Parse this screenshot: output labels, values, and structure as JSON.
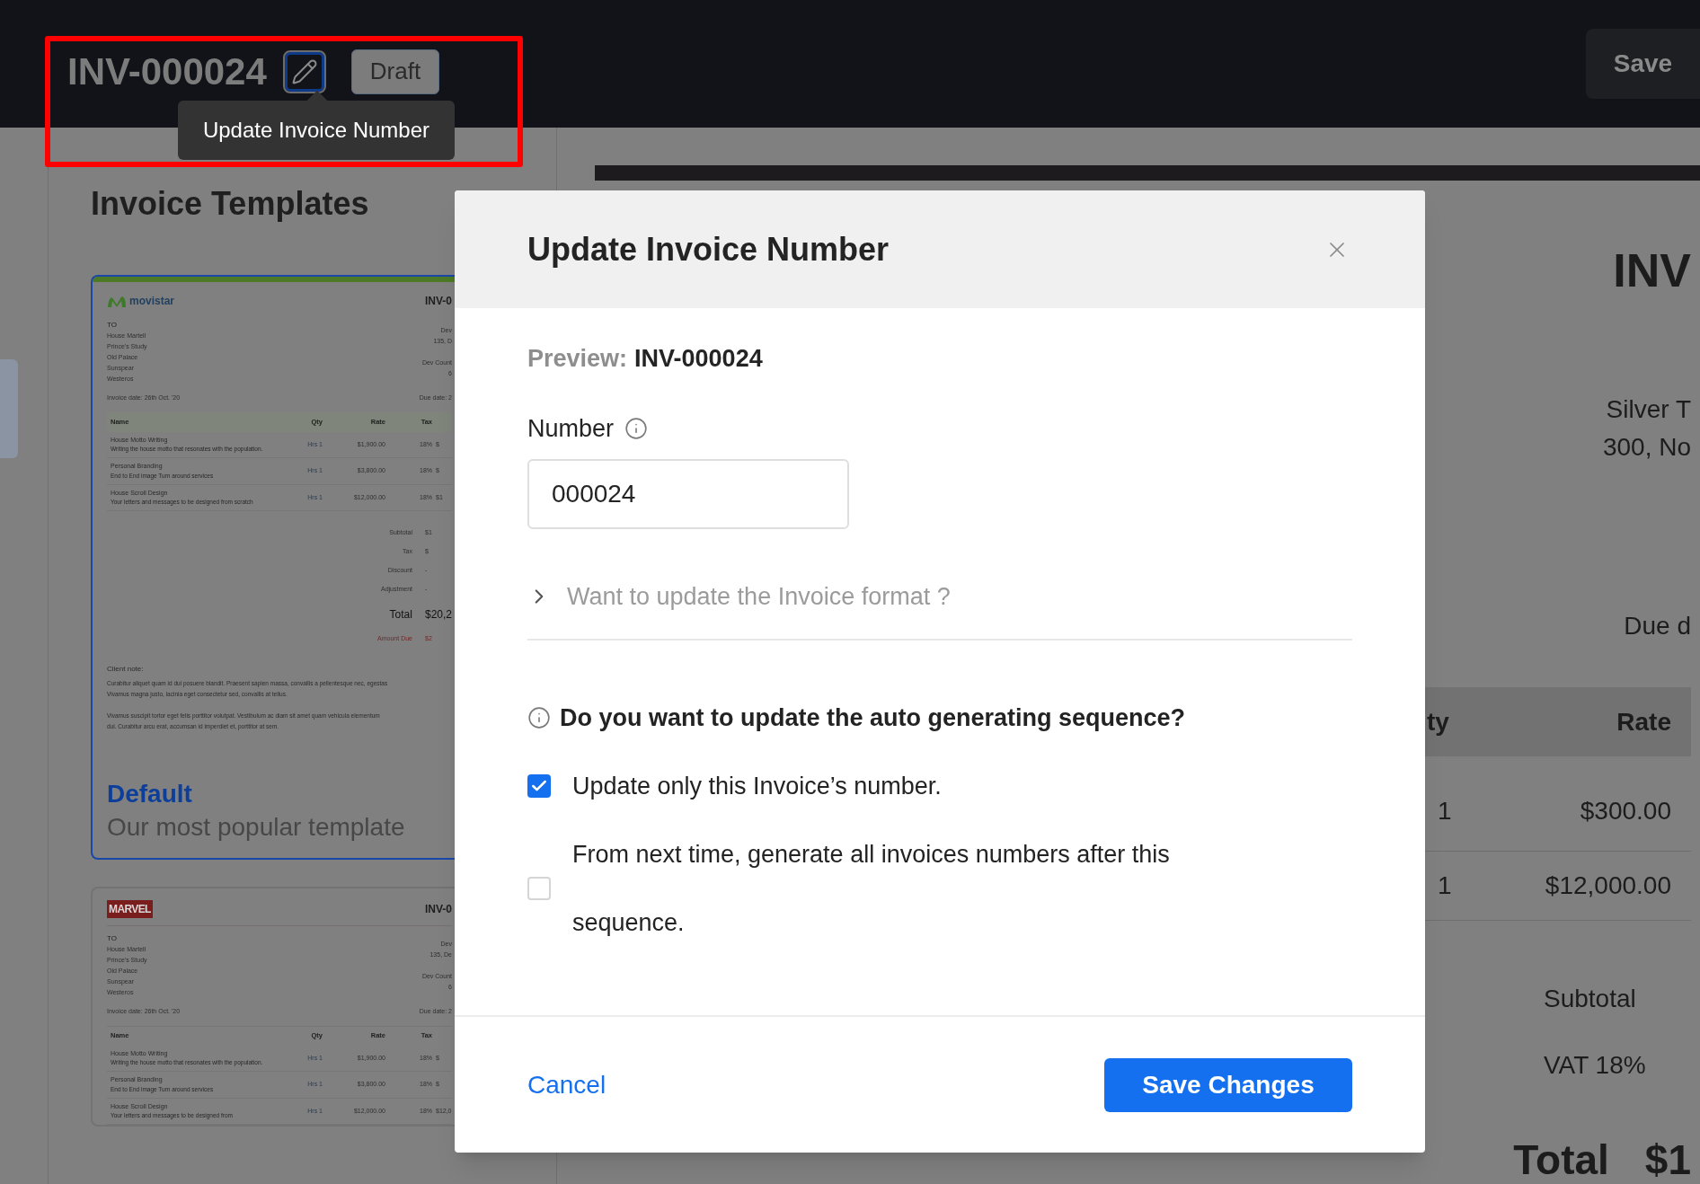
{
  "header": {
    "invoice_number": "INV-000024",
    "edit_tooltip": "Update Invoice Number",
    "status": "Draft",
    "save": "Save"
  },
  "templates_panel": {
    "title": "Invoice Templates",
    "templates": [
      {
        "selected": true,
        "logo": {
          "kind": "movistar",
          "text": "movistar"
        },
        "number": "INV-0",
        "to_label": "TO",
        "to_lines": [
          "House Martell",
          "Prince's Study",
          "Old Palace",
          "Sunspear",
          "Westeros"
        ],
        "from_lines": [
          "Dev",
          "135, D"
        ],
        "country_lines": [
          "Dev Count",
          "6"
        ],
        "invoice_date": "Invoice date: 26th Oct. '20",
        "due_date": "Due date: 2",
        "columns": [
          "Name",
          "Qty",
          "Rate",
          "Tax"
        ],
        "items": [
          {
            "name": "House Motto Writing",
            "description": "Writing the house motto that resonates with the population.",
            "qty": "Hrs 1",
            "rate": "$1,900.00",
            "tax": "18%",
            "amount": "$"
          },
          {
            "name": "Personal Branding",
            "description": "End to End image Turn around services",
            "qty": "Hrs 1",
            "rate": "$3,800.00",
            "tax": "18%",
            "amount": "$"
          },
          {
            "name": "House Scroll Design",
            "description": "Your letters and messages to be designed from scratch",
            "qty": "Hrs 1",
            "rate": "$12,000.00",
            "tax": "18%",
            "amount": "$1"
          }
        ],
        "totals": [
          {
            "kind": "plain",
            "label": "Subtotal",
            "value": "$1"
          },
          {
            "kind": "plain",
            "label": "Tax",
            "value": "$"
          },
          {
            "kind": "plain",
            "label": "Discount",
            "value": "-"
          },
          {
            "kind": "plain",
            "label": "Adjustment",
            "value": "-"
          },
          {
            "kind": "total",
            "label": "Total",
            "value": "$20,2"
          },
          {
            "kind": "due",
            "label": "Amount Due",
            "value": "$2"
          }
        ],
        "note_title": "Client note:",
        "note_paragraphs": [
          [
            "Curabitur aliquet quam id dui posuere blandit. Praesent sapien massa, convallis a pellentesque nec, egestas",
            "Vivamus magna justo, lacinia eget consectetur sed, convallis at tellus."
          ],
          [
            "Vivamus suscipit tortor eget felis porttitor volutpat. Vestibulum ac diam sit amet quam vehicula elementum",
            "dui. Curabitur arcu erat, accumsan id imperdiet et, porttitor at sem."
          ]
        ],
        "name": "Default",
        "subtitle": "Our most popular template"
      },
      {
        "selected": false,
        "logo": {
          "kind": "marvel",
          "text": "MARVEL"
        },
        "number": "INV-0",
        "to_label": "TO",
        "to_lines": [
          "House Martell",
          "Prince's Study",
          "Old Palace",
          "Sunspear",
          "Westeros"
        ],
        "from_lines": [
          "Dev",
          "135, De"
        ],
        "country_lines": [
          "Dev Count",
          "6"
        ],
        "invoice_date": "Invoice date: 26th Oct. '20",
        "due_date": "Due date: 2",
        "columns": [
          "Name",
          "Qty",
          "Rate",
          "Tax"
        ],
        "items": [
          {
            "name": "House Motto Writing",
            "description": "Writing the house motto that resonates with the population.",
            "qty": "Hrs 1",
            "rate": "$1,900.00",
            "tax": "18%",
            "amount": "$"
          },
          {
            "name": "Personal Branding",
            "description": "End to End image Turn around services",
            "qty": "Hrs 1",
            "rate": "$3,800.00",
            "tax": "18%",
            "amount": "$"
          },
          {
            "name": "House Scroll Design",
            "description": "Your letters and messages to be designed from",
            "qty": "Hrs 1",
            "rate": "$12,000.00",
            "tax": "18%",
            "amount": "$12,0"
          }
        ]
      }
    ]
  },
  "invoice_preview": {
    "number": "INV",
    "from_lines": [
      "Silver T",
      "300, No"
    ],
    "due_label": "Due d",
    "columns": [
      "ty",
      "Rate"
    ],
    "rows": [
      {
        "qty": "1",
        "rate": "$300.00"
      },
      {
        "qty": "1",
        "rate": "$12,000.00"
      }
    ],
    "totals": [
      {
        "kind": "plain",
        "label": "Subtotal"
      },
      {
        "kind": "plain",
        "label": "VAT 18%"
      },
      {
        "kind": "total",
        "label": "Total",
        "value": "$1"
      }
    ]
  },
  "modal": {
    "title": "Update Invoice Number",
    "preview_label": "Preview:",
    "preview_value": "INV-000024",
    "number_label": "Number",
    "number_value": "000024",
    "format_toggle": {
      "label": "Want to update the Invoice format ?",
      "expanded": false
    },
    "question": "Do you want to update the auto generating sequence?",
    "options": [
      {
        "label": "Update only this Invoice’s number.",
        "checked": true
      },
      {
        "label": "From next time, generate all invoices numbers after this sequence.",
        "checked": false
      }
    ],
    "cancel": "Cancel",
    "save": "Save Changes"
  }
}
